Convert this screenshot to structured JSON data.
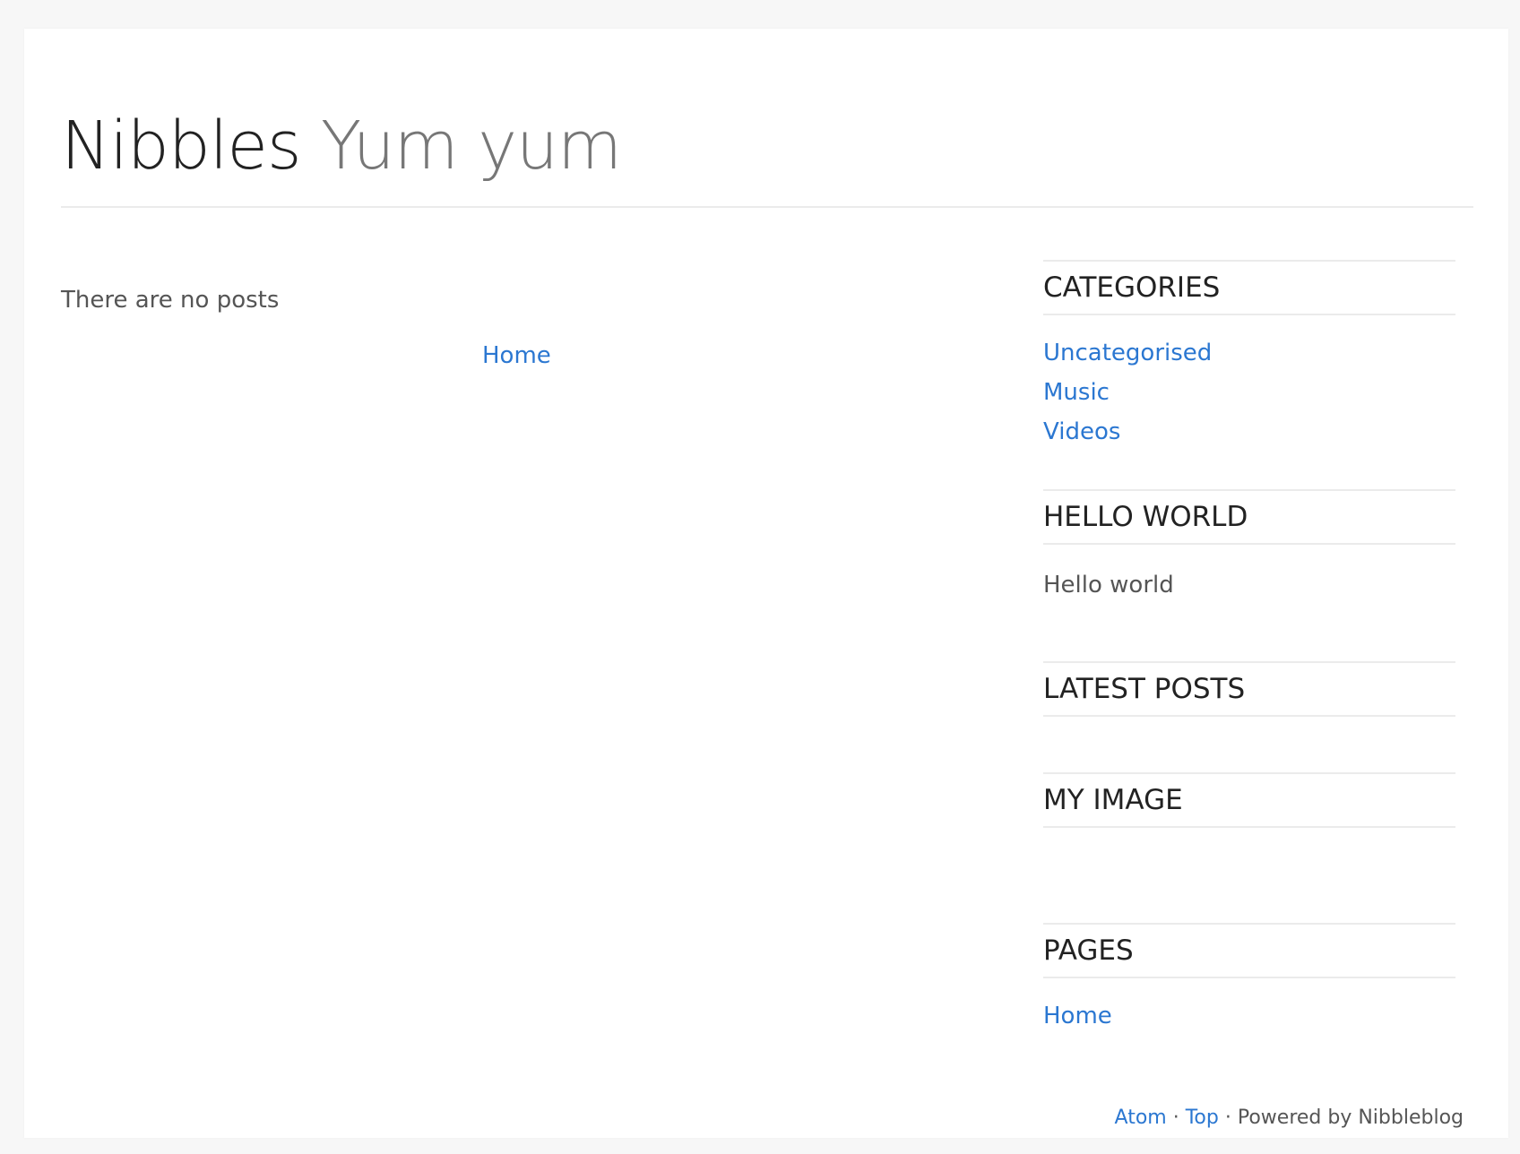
{
  "header": {
    "blog_name": "Nibbles",
    "slogan": "Yum yum"
  },
  "main": {
    "empty_message": "There are no posts",
    "home_link": "Home"
  },
  "sidebar": {
    "categories": {
      "title": "CATEGORIES",
      "items": [
        "Uncategorised",
        "Music",
        "Videos"
      ]
    },
    "hello_world": {
      "title": "HELLO WORLD",
      "text": "Hello world"
    },
    "latest_posts": {
      "title": "LATEST POSTS"
    },
    "my_image": {
      "title": "MY IMAGE"
    },
    "pages": {
      "title": "PAGES",
      "items": [
        "Home"
      ]
    }
  },
  "footer": {
    "atom_link": "Atom",
    "separator": "·",
    "top_link": "Top",
    "powered_by": "Powered by Nibbleblog"
  },
  "colors": {
    "link": "#2b77d1",
    "heading": "#222222",
    "text": "#555555",
    "background": "#f7f7f7",
    "panel": "#ffffff"
  }
}
